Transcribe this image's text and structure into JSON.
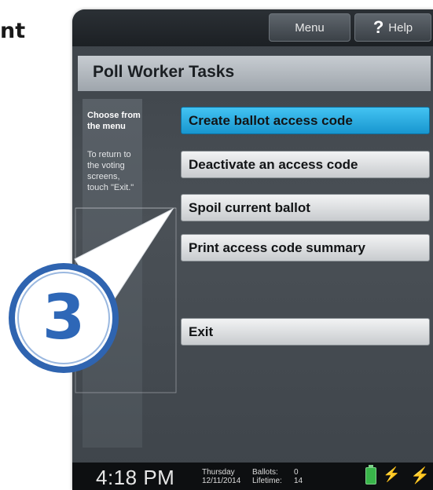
{
  "heading_fragment": "nt",
  "topbar": {
    "menu_label": "Menu",
    "help_label": "Help",
    "help_glyph": "?"
  },
  "title": "Poll Worker Tasks",
  "sidebar": {
    "heading": "Choose from the menu",
    "body": "To return to the voting screens, touch \"Exit.\""
  },
  "tasks": [
    {
      "label": "Create ballot access code",
      "active": true
    },
    {
      "label": "Deactivate an access code",
      "active": false
    },
    {
      "label": "Spoil current ballot",
      "active": false
    },
    {
      "label": "Print access code summary",
      "active": false
    },
    {
      "label": "Exit",
      "active": false
    }
  ],
  "status": {
    "time": "4:18 PM",
    "day": "Thursday",
    "date": "12/11/2014",
    "ballots_label": "Ballots:",
    "ballots_value": "0",
    "lifetime_label": "Lifetime:",
    "lifetime_value": "14"
  },
  "callout": {
    "number": "3"
  },
  "colors": {
    "active_button": "#1fa6e0",
    "callout_ring": "#3b73c4",
    "battery": "#39b54a"
  }
}
